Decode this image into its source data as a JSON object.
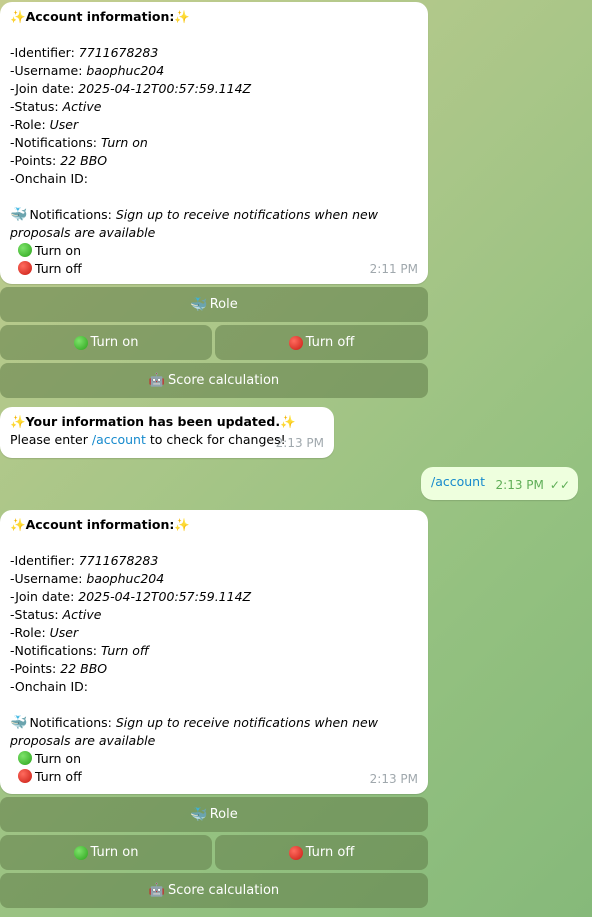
{
  "colors": {
    "link": "#168acd",
    "bubble_in": "#ffffff",
    "bubble_out": "#eeffde",
    "keyboard_button": "#607c48"
  },
  "icons": {
    "sparkle": "✨",
    "whale": "🐳",
    "green_circle": "green-circle-icon",
    "red_circle": "red-circle-icon",
    "robot": "🤖"
  },
  "msg1": {
    "title": "Account information:",
    "identifier_label": "-Identifier: ",
    "identifier": "7711678283",
    "username_label": "-Username: ",
    "username": "baophuc204",
    "join_label": "-Join date: ",
    "join": "2025-04-12T00:57:59.114Z",
    "status_label": "-Status: ",
    "status": "Active",
    "role_label": "-Role: ",
    "role": "User",
    "notif_label": "-Notifications: ",
    "notif": "Turn on",
    "points_label": "-Points: ",
    "points": "22 BBO",
    "onchain_label": "-Onchain ID:",
    "notif_prompt_label": "Notifications: ",
    "notif_prompt": "Sign up to receive notifications when new proposals are available",
    "opt_on": "Turn on",
    "opt_off": "Turn off",
    "time": "2:11 PM"
  },
  "kb1": {
    "role": "Role",
    "on": "Turn on",
    "off": "Turn off",
    "score": "Score calculation"
  },
  "msg2": {
    "title": "Your information has been updated.",
    "text_pre": "Please enter ",
    "link": "/account",
    "text_post": " to check for changes!",
    "time": "2:13 PM"
  },
  "out1": {
    "text": "/account",
    "time": "2:13 PM"
  },
  "msg3": {
    "title": "Account information:",
    "identifier_label": "-Identifier: ",
    "identifier": "7711678283",
    "username_label": "-Username: ",
    "username": "baophuc204",
    "join_label": "-Join date: ",
    "join": "2025-04-12T00:57:59.114Z",
    "status_label": "-Status: ",
    "status": "Active",
    "role_label": "-Role: ",
    "role": "User",
    "notif_label": "-Notifications: ",
    "notif": "Turn off",
    "points_label": "-Points: ",
    "points": "22 BBO",
    "onchain_label": "-Onchain ID:",
    "notif_prompt_label": "Notifications: ",
    "notif_prompt": "Sign up to receive notifications when new proposals are available",
    "opt_on": "Turn on",
    "opt_off": "Turn off",
    "time": "2:13 PM"
  },
  "kb2": {
    "role": "Role",
    "on": "Turn on",
    "off": "Turn off",
    "score": "Score calculation"
  }
}
